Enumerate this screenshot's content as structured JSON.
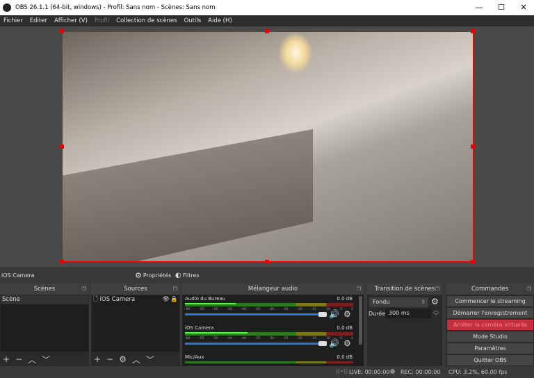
{
  "window": {
    "title": "OBS 26.1.1 (64-bit, windows) - Profil: Sans nom - Scènes: Sans nom",
    "minimize": "—",
    "maximize": "☐",
    "close": "✕"
  },
  "menu": [
    "Fichier",
    "Editer",
    "Afficher (V)",
    "Profil",
    "Collection de scènes",
    "Outils",
    "Aide (H)"
  ],
  "source_toolbar": {
    "selected": "iOS Camera",
    "properties": "Propriétés",
    "filters": "Filtres"
  },
  "scenes": {
    "title": "Scènes",
    "items": [
      "Scène"
    ]
  },
  "sources": {
    "title": "Sources",
    "items": [
      "iOS Camera"
    ]
  },
  "mixer": {
    "title": "Mélangeur audio",
    "ticks": [
      "-60",
      "-55",
      "-50",
      "-45",
      "-40",
      "-35",
      "-30",
      "-25",
      "-20",
      "-15",
      "-10",
      "-5",
      "0"
    ],
    "tracks": [
      {
        "name": "Audio du Bureau",
        "db": "0.0 dB",
        "level": 0.3,
        "volume": 1.0
      },
      {
        "name": "iOS Camera",
        "db": "0.0 dB",
        "level": 0.37,
        "volume": 1.0
      },
      {
        "name": "Mic/Aux",
        "db": "0.0 dB"
      }
    ]
  },
  "transition": {
    "title": "Transition de scènes",
    "selected": "Fondu",
    "duration_label": "Durée",
    "duration": "300 ms"
  },
  "commands": {
    "title": "Commandes",
    "buttons": [
      "Commencer le streaming",
      "Démarrer l'enregistrement",
      "Arrêter la caméra virtuelle",
      "Mode Studio",
      "Paramètres",
      "Quitter OBS"
    ],
    "active_color": "#c6303e"
  },
  "status": {
    "live": "LIVE: 00:00:00",
    "rec": "REC: 00:00:00",
    "cpu": "CPU: 3.2%, 60.00 fps"
  }
}
